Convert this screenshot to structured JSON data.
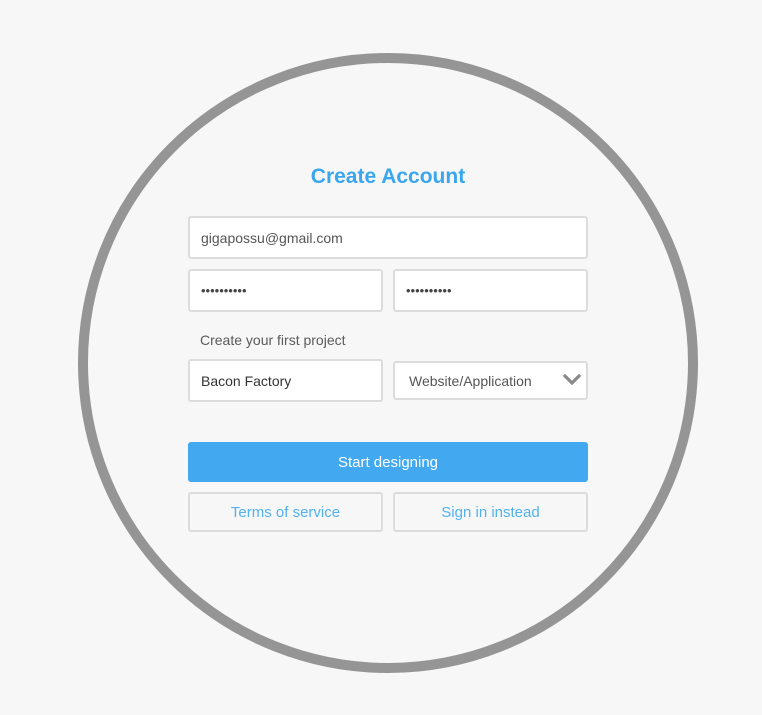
{
  "form": {
    "title": "Create Account",
    "email_value": "gigapossu@gmail.com",
    "password_value": "••••••••••",
    "password_confirm_value": "••••••••••",
    "project_section_label": "Create your first project",
    "project_name_value": "Bacon Factory",
    "project_type_selected": "Website/Application",
    "primary_button_label": "Start designing",
    "terms_button_label": "Terms of service",
    "signin_button_label": "Sign in instead"
  },
  "icons": {
    "select_arrow": "chevron-down-icon"
  },
  "colors": {
    "accent": "#3aa6ee",
    "primary_button": "#42a9f1",
    "ring": "#959595",
    "background": "#f7f7f7"
  }
}
